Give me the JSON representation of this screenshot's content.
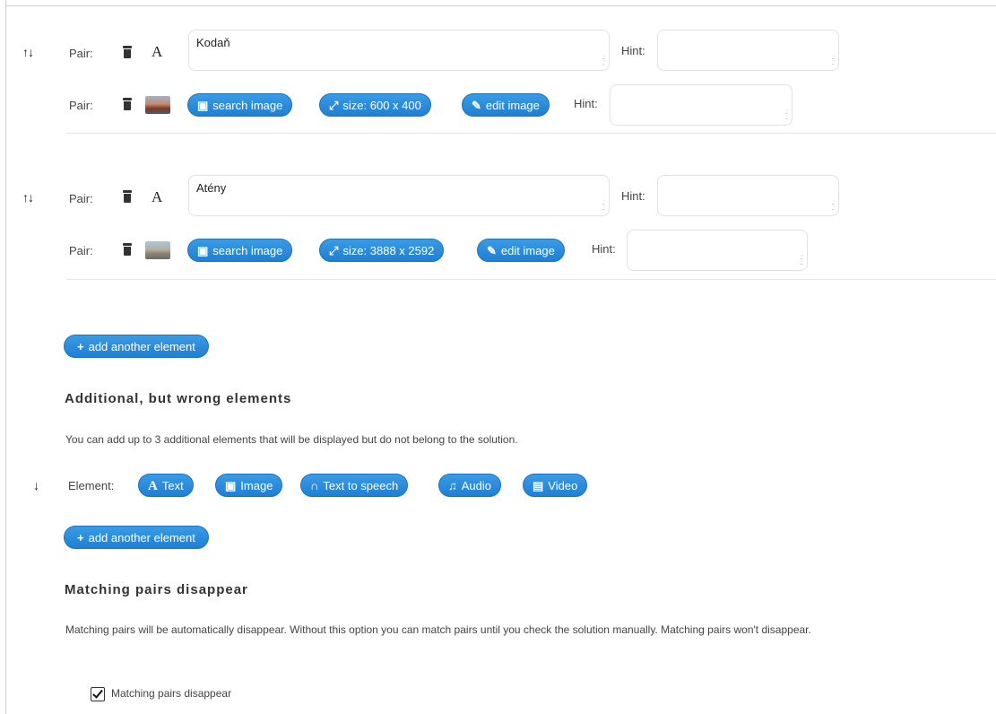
{
  "pairs": [
    {
      "arrows": "↑↓",
      "text_row": {
        "label": "Pair:",
        "value": "Kodaň",
        "hint_label": "Hint:",
        "hint_value": ""
      },
      "image_row": {
        "label": "Pair:",
        "search": "search image",
        "size": "size: 600 x 400",
        "edit": "edit image",
        "hint_label": "Hint:",
        "hint_value": ""
      }
    },
    {
      "arrows": "↑↓",
      "text_row": {
        "label": "Pair:",
        "value": "Atény",
        "hint_label": "Hint:",
        "hint_value": ""
      },
      "image_row": {
        "label": "Pair:",
        "search": "search image",
        "size": "size: 3888 x 2592",
        "edit": "edit image",
        "hint_label": "Hint:",
        "hint_value": ""
      }
    }
  ],
  "add_button_1": "add another element",
  "wrong_section": {
    "heading": "Additional, but wrong elements",
    "description": "You can add up to 3 additional elements that will be displayed but do not belong to the solution.",
    "arrow": "↓",
    "element_label": "Element:",
    "buttons": [
      "Text",
      "Image",
      "Text to speech",
      "Audio",
      "Video"
    ]
  },
  "add_button_2": "add another element",
  "disappear_section": {
    "heading": "Matching pairs disappear",
    "description": "Matching pairs will be automatically disappear. Without this option you can match pairs until you check the solution manually. Matching pairs won't disappear.",
    "checkbox_label": "Matching pairs disappear",
    "checked": true
  },
  "colors": {
    "button": "#2a8bdc",
    "border": "#e3e3e3"
  }
}
